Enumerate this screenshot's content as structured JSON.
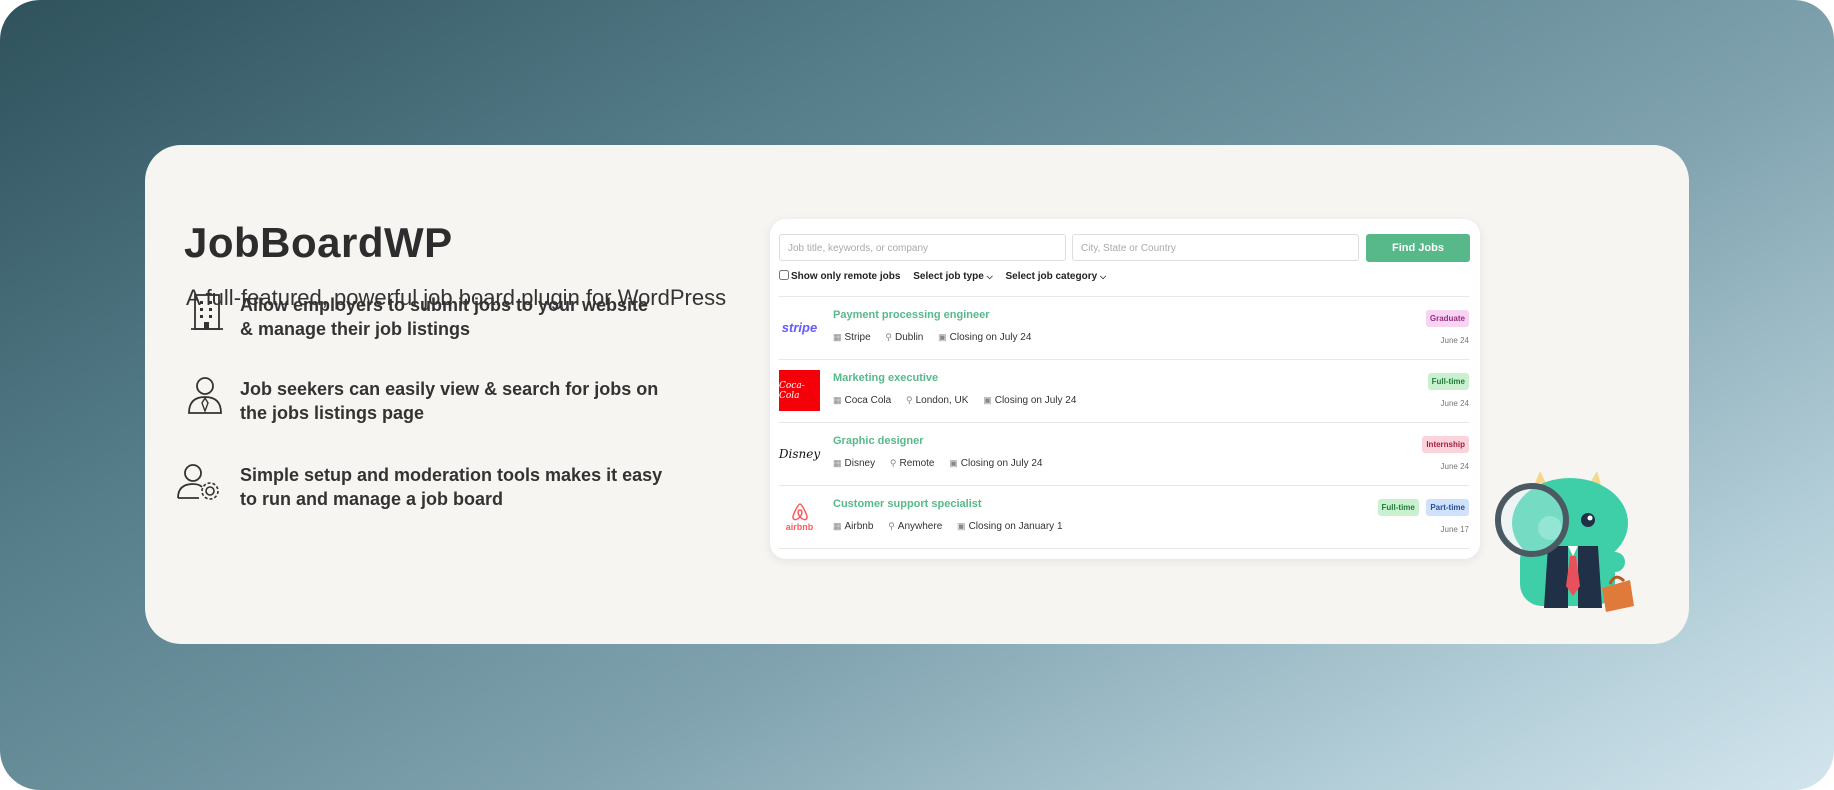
{
  "hero": {
    "title": "JobBoardWP",
    "subtitle": "A full-featured, powerful job board plugin for WordPress",
    "features": [
      {
        "icon": "building-icon",
        "text_line1": "Allow employers to submit jobs to your website",
        "text_line2": "& manage their job listings"
      },
      {
        "icon": "job-seeker-icon",
        "text_line1": "Job seekers can easily view & search for jobs on",
        "text_line2": "the jobs listings page"
      },
      {
        "icon": "user-settings-icon",
        "text_line1": "Simple setup and moderation tools makes it easy",
        "text_line2": "to run and manage a job board"
      }
    ]
  },
  "search": {
    "keywords_placeholder": "Job title, keywords, or company",
    "location_placeholder": "City, State or Country",
    "find_label": "Find Jobs",
    "remote_label": "Show only remote jobs",
    "job_type_label": "Select job type",
    "job_category_label": "Select job category"
  },
  "jobs": [
    {
      "title": "Payment processing engineer",
      "company": "Stripe",
      "location": "Dublin",
      "closing": "Closing on July 24",
      "date": "June 24",
      "logo_text": "stripe",
      "tags": [
        "Graduate"
      ]
    },
    {
      "title": "Marketing executive",
      "company": "Coca Cola",
      "location": "London, UK",
      "closing": "Closing on July 24",
      "date": "June 24",
      "logo_text": "Coca-Cola",
      "tags": [
        "Full-time"
      ]
    },
    {
      "title": "Graphic designer",
      "company": "Disney",
      "location": "Remote",
      "closing": "Closing on July 24",
      "date": "June 24",
      "logo_text": "Disney",
      "tags": [
        "Internship"
      ]
    },
    {
      "title": "Customer support specialist",
      "company": "Airbnb",
      "location": "Anywhere",
      "closing": "Closing on January 1",
      "date": "June 17",
      "logo_text": "airbnb",
      "tags": [
        "Full-time",
        "Part-time"
      ]
    }
  ],
  "colors": {
    "accent": "#57b98a",
    "stripe": "#635bff",
    "cocacola": "#f40009",
    "airbnb": "#ff5a5f",
    "tag_graduate": "#f7d4f1",
    "tag_fulltime": "#c9f0cf",
    "tag_internship": "#fbd3dd",
    "tag_parttime": "#cfe1fb"
  },
  "mascot": {
    "icon": "monster-mascot-icon"
  }
}
